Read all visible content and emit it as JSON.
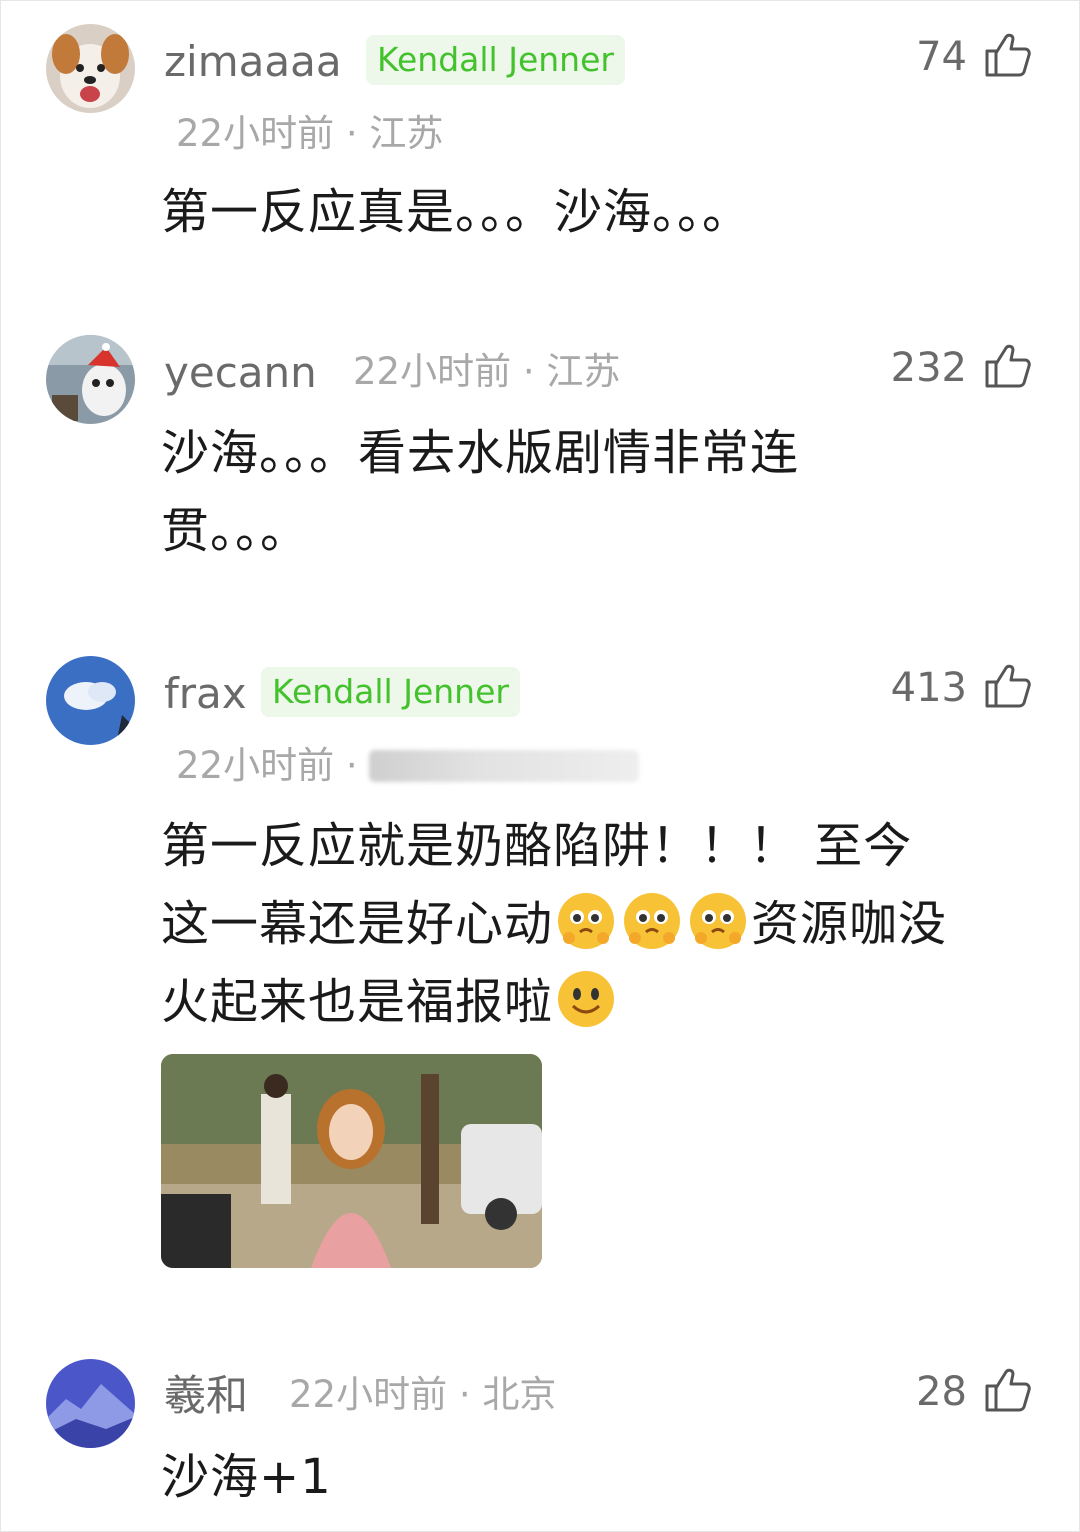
{
  "comments": [
    {
      "user": "zimaaaa",
      "badge": "Kendall Jenner",
      "time": "22小时前",
      "location": "江苏",
      "likes": "74",
      "text": "第一反应真是。。。沙海。。。",
      "avatar": "dog-avatar"
    },
    {
      "user": "yecann",
      "badge": "",
      "time": "22小时前",
      "location": "江苏",
      "likes": "232",
      "text_line1": "沙海。。。看去水版剧情非常连",
      "text_line2": "贯。。。",
      "avatar": "panda-avatar"
    },
    {
      "user": "frax",
      "badge": "Kendall Jenner",
      "time": "22小时前",
      "location": "",
      "likes": "413",
      "text_line1": "第一反应就是奶酪陷阱！！！ 至今",
      "text_line2a": "这一幕还是好心动",
      "text_line2b": "资源咖没",
      "text_line3": "火起来也是福报啦",
      "emojis": [
        "pleading-face-icon",
        "pleading-face-icon",
        "pleading-face-icon",
        "smile-face-icon"
      ],
      "avatar": "sky-avatar"
    },
    {
      "user": "羲和",
      "badge": "",
      "time": "22小时前",
      "location": "北京",
      "likes": "28",
      "text": "沙海+1",
      "avatar": "mountain-avatar"
    }
  ],
  "separator": "·",
  "colors": {
    "badge_text": "#43c22e",
    "badge_bg": "#eef8ea",
    "meta": "#a8a8a8",
    "name": "#6a6a6a"
  }
}
